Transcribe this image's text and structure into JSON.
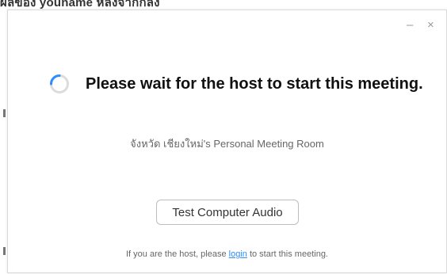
{
  "background": {
    "partial_text": "ผลของ youname หลังจากกลง"
  },
  "window": {
    "minimize_label": "–",
    "close_label": "×"
  },
  "main": {
    "status_message": "Please wait for the host to start this meeting.",
    "room_name": "จังหวัด เชียงใหม่'s Personal Meeting Room",
    "test_audio_label": "Test Computer Audio",
    "footer": {
      "prefix": "If you are the host, please ",
      "link": "login",
      "suffix": " to start this meeting."
    }
  },
  "colors": {
    "link": "#2d8cff",
    "spinner_arc": "#2d8cff",
    "spinner_track": "#dcdcdc"
  }
}
